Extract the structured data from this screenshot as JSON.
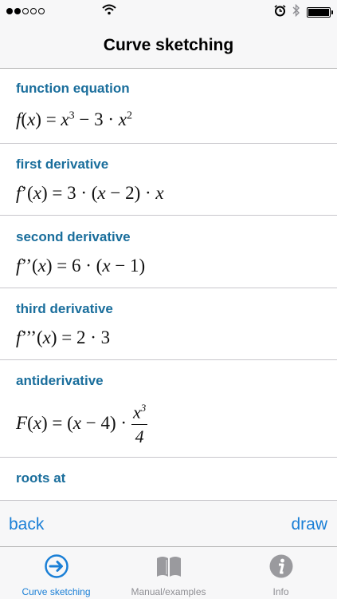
{
  "status_bar": {
    "signal_filled": 2,
    "signal_total": 5,
    "battery_level": 1.0
  },
  "nav": {
    "title": "Curve sketching"
  },
  "rows": [
    {
      "label": "function equation"
    },
    {
      "label": "first derivative"
    },
    {
      "label": "second derivative"
    },
    {
      "label": "third derivative"
    },
    {
      "label": "antiderivative"
    },
    {
      "label": "roots at"
    }
  ],
  "actions": {
    "back": "back",
    "draw": "draw"
  },
  "tabs": [
    {
      "label": "Curve sketching",
      "icon": "arrow-circle-icon",
      "active": true
    },
    {
      "label": "Manual/examples",
      "icon": "book-icon",
      "active": false
    },
    {
      "label": "Info",
      "icon": "info-icon",
      "active": false
    }
  ],
  "colors": {
    "accent": "#1a7fd6",
    "label": "#1a6e9c",
    "inactive": "#8e8e93"
  }
}
